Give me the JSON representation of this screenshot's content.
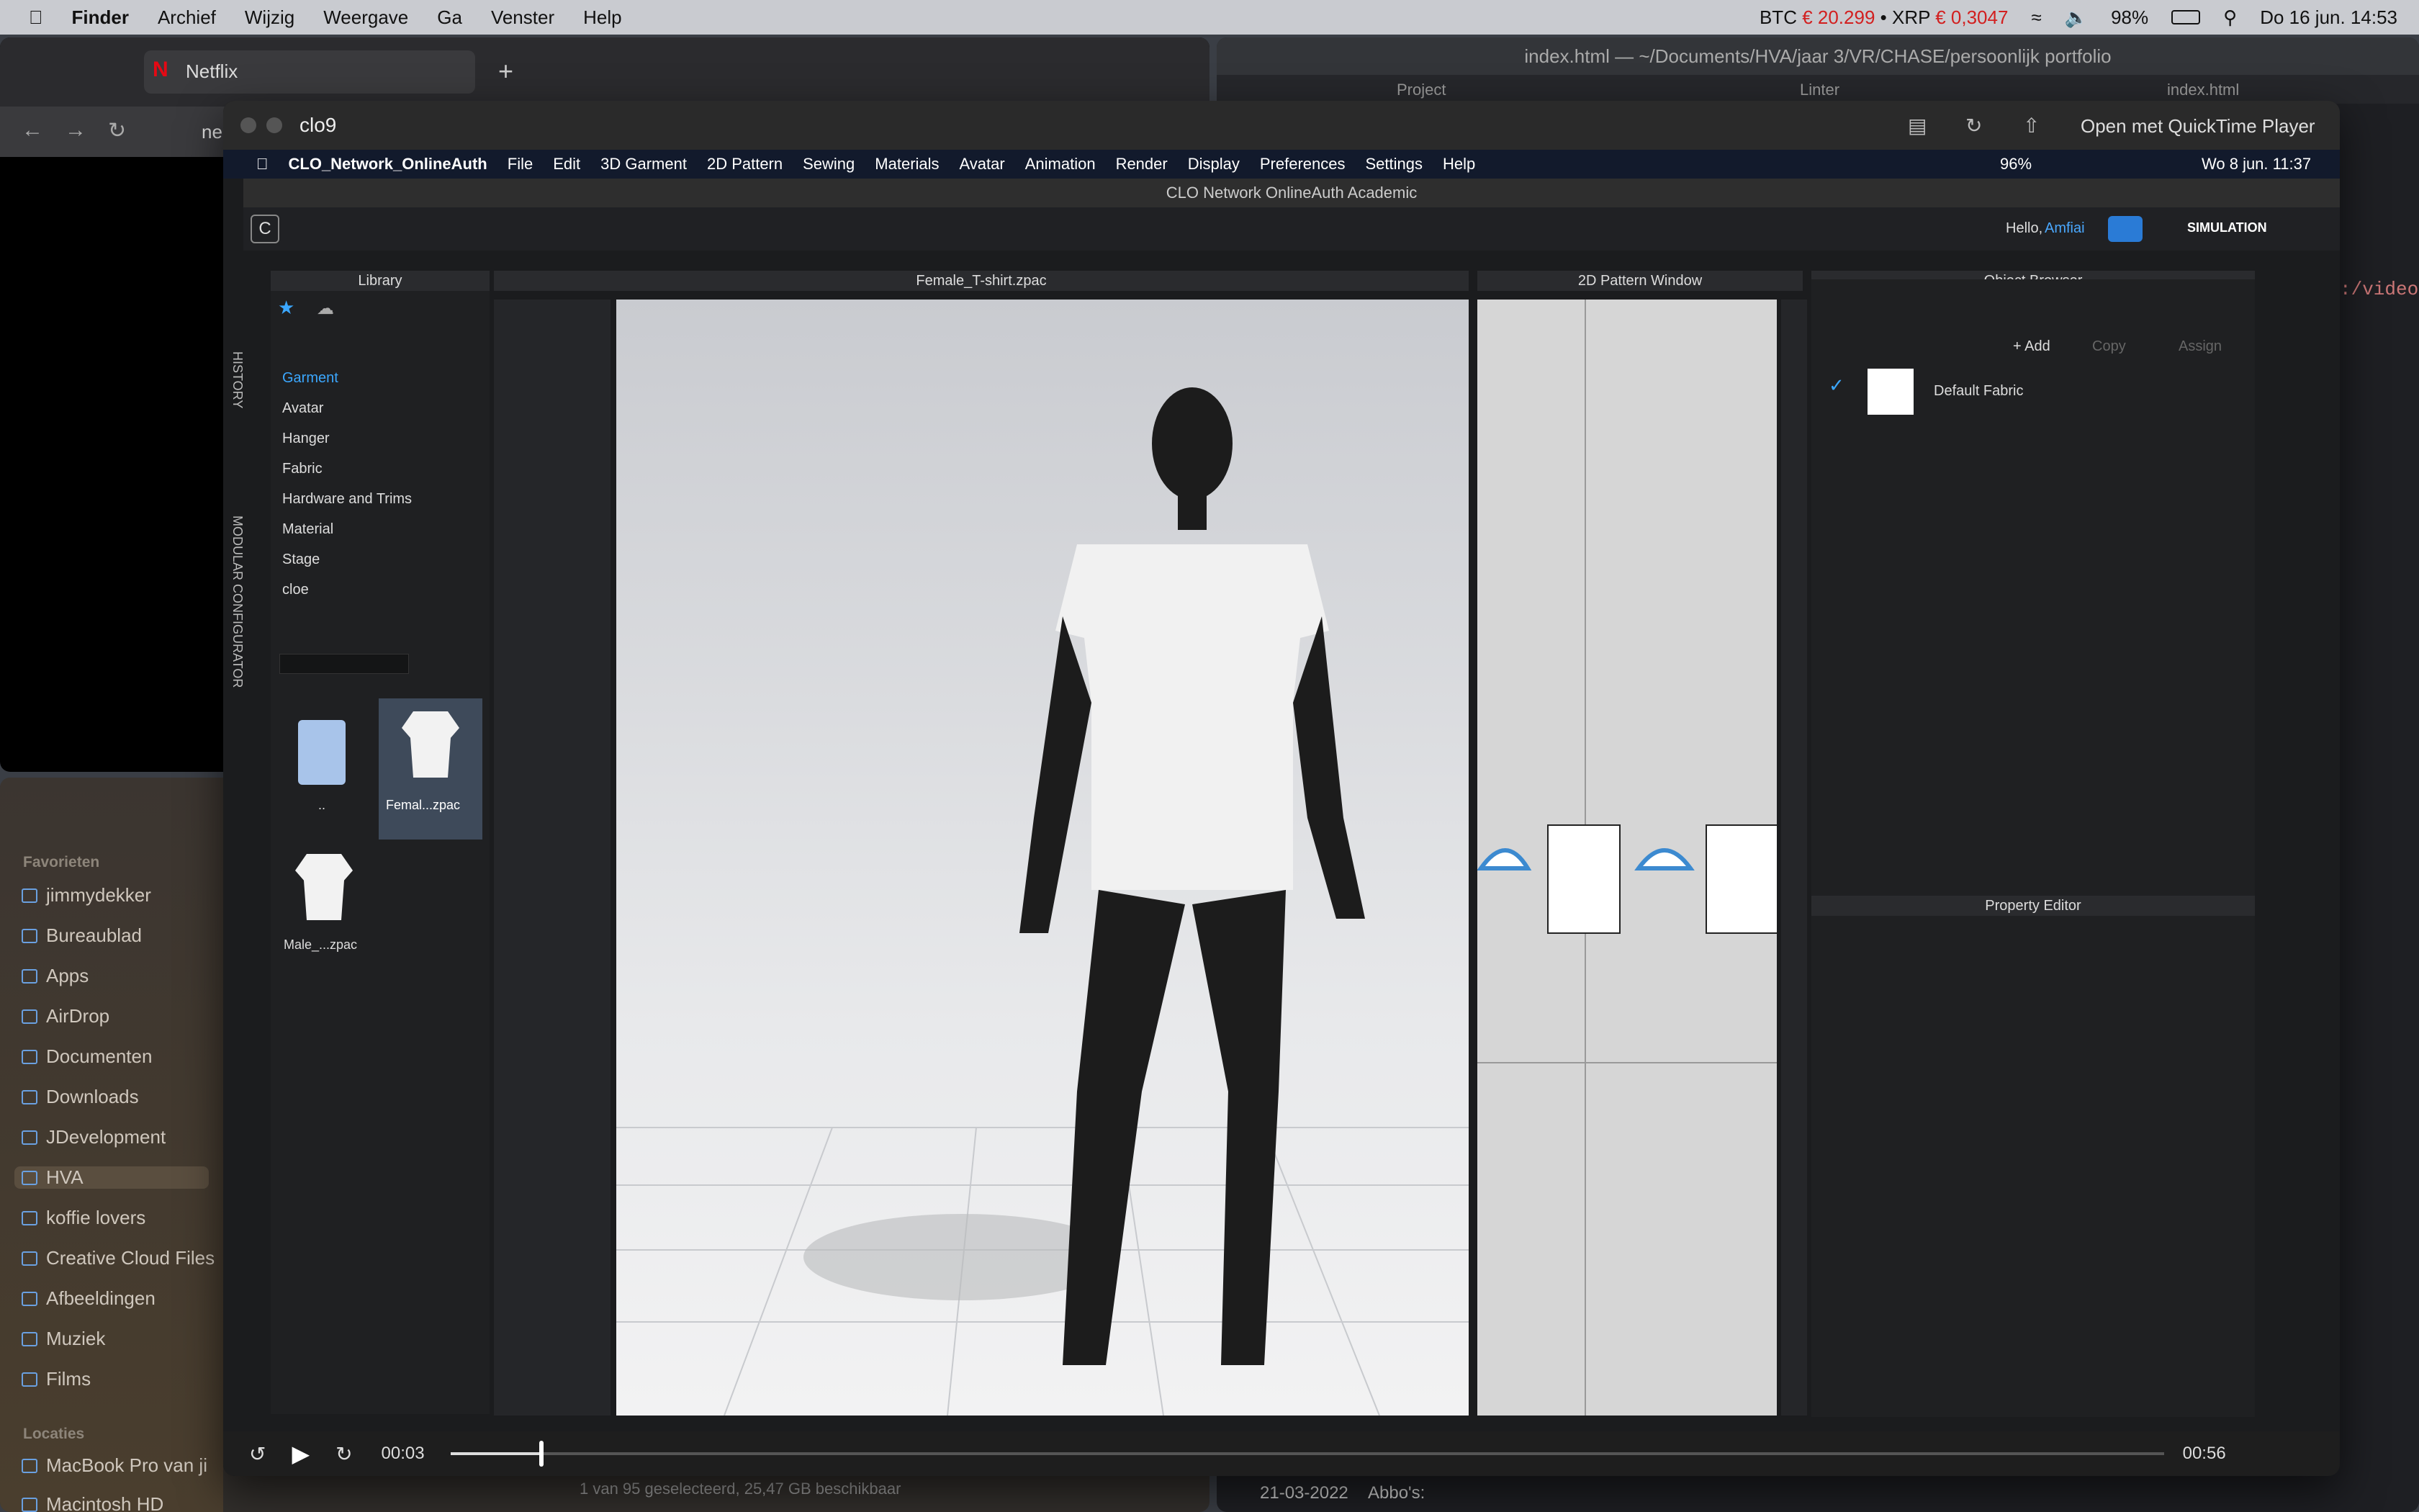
{
  "menubar": {
    "items": [
      "Finder",
      "Archief",
      "Wijzig",
      "Weergave",
      "Ga",
      "Venster",
      "Help"
    ],
    "btc_label": "BTC",
    "btc_value": "€ 20.299",
    "xrp_label": "• XRP",
    "xrp_value": "€ 0,3047",
    "battery": "98%",
    "datetime": "Do 16 jun.  14:53"
  },
  "netflix": {
    "tab_title": "Netflix",
    "address": "ne"
  },
  "editor": {
    "title": "index.html — ~/Documents/HVA/jaar 3/VR/CHASE/persoonlijk portfolio",
    "tab1": "Project",
    "tab2": "Linter",
    "tab3": "index.html",
    "snippet": ":/video",
    "date": "21-03-2022",
    "abbo": "Abbo's:"
  },
  "finder": {
    "favorites_header": "Favorieten",
    "favorites": [
      "jimmydekker",
      "Bureaublad",
      "Apps",
      "AirDrop",
      "Documenten",
      "Downloads",
      "JDevelopment",
      "HVA",
      "koffie lovers",
      "Creative Cloud Files",
      "Afbeeldingen",
      "Muziek",
      "Films"
    ],
    "locations_header": "Locaties",
    "locations": [
      "MacBook Pro van ji",
      "Macintosh HD"
    ],
    "status": "1 van 95 geselecteerd, 25,47 GB beschikbaar"
  },
  "quicktime": {
    "title": "clo9",
    "open_with": "Open met QuickTime Player",
    "time_current": "00:03",
    "time_total": "00:56",
    "progress": 0.053
  },
  "clo": {
    "menu": [
      "CLO_Network_OnlineAuth",
      "File",
      "Edit",
      "3D Garment",
      "2D Pattern",
      "Sewing",
      "Materials",
      "Avatar",
      "Animation",
      "Render",
      "Display",
      "Preferences",
      "Settings",
      "Help"
    ],
    "inner_battery": "96%",
    "inner_datetime": "Wo 8 jun.  11:37",
    "window_title": "CLO Network OnlineAuth Academic",
    "hello": "Hello,",
    "user": "Amfiai",
    "simulation": "SIMULATION",
    "side_tabs": [
      "HISTORY",
      "MODULAR CONFIGURATOR"
    ],
    "library": {
      "title": "Library",
      "items": [
        "Garment",
        "Avatar",
        "Hanger",
        "Fabric",
        "Hardware and Trims",
        "Material",
        "Stage",
        "cloe"
      ],
      "files": [
        {
          "name": ".."
        },
        {
          "name": "Femal...zpac"
        },
        {
          "name": "Male_...zpac"
        }
      ]
    },
    "view3d_title": "Female_T-shirt.zpac",
    "pattern_title": "2D Pattern Window",
    "object_browser": {
      "title": "Object Browser",
      "add": "Add",
      "copy": "Copy",
      "assign": "Assign",
      "fabric": "Default Fabric"
    },
    "property_editor": "Property Editor"
  }
}
